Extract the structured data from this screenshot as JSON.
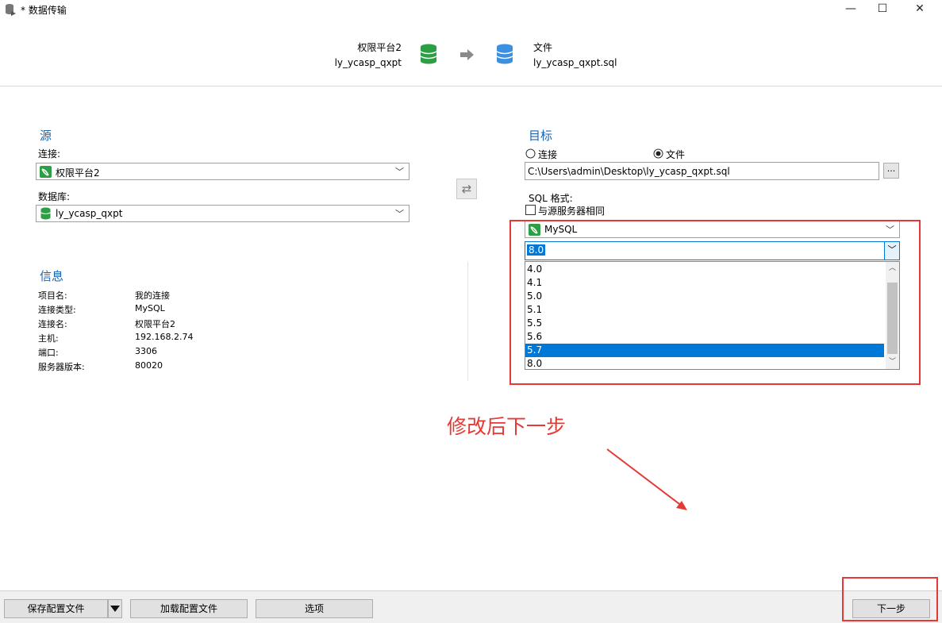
{
  "window": {
    "title": "* 数据传输",
    "minimize": "—",
    "maximize": "☐",
    "close": "✕"
  },
  "header": {
    "source_line1": "权限平台2",
    "source_line2": "ly_ycasp_qxpt",
    "target_line1": "文件",
    "target_line2": "ly_ycasp_qxpt.sql"
  },
  "source": {
    "title": "源",
    "connection_label": "连接:",
    "connection_value": "权限平台2",
    "database_label": "数据库:",
    "database_value": "ly_ycasp_qxpt"
  },
  "info": {
    "title": "信息",
    "rows": [
      {
        "label": "项目名:",
        "value": "我的连接"
      },
      {
        "label": "连接类型:",
        "value": "MySQL"
      },
      {
        "label": "连接名:",
        "value": "权限平台2"
      },
      {
        "label": "主机:",
        "value": "192.168.2.74"
      },
      {
        "label": "端口:",
        "value": "3306"
      },
      {
        "label": "服务器版本:",
        "value": "80020"
      }
    ]
  },
  "target": {
    "title": "目标",
    "radio_connection": "连接",
    "radio_file": "文件",
    "selected_radio": "文件",
    "file_path": "C:\\Users\\admin\\Desktop\\ly_ycasp_qxpt.sql",
    "browse_label": "...",
    "sql_format_label": "SQL 格式:",
    "same_as_source_label": "与源服务器相同",
    "same_as_source_checked": false,
    "format_value": "MySQL",
    "version_value": "8.0",
    "version_options": [
      "4.0",
      "4.1",
      "5.0",
      "5.1",
      "5.5",
      "5.6",
      "5.7",
      "8.0"
    ],
    "highlighted_option": "5.7"
  },
  "annotation": {
    "text": "修改后下一步",
    "color": "#e53935"
  },
  "buttons": {
    "save_profile": "保存配置文件",
    "load_profile": "加载配置文件",
    "options": "选项",
    "next": "下一步"
  },
  "colors": {
    "accent_blue": "#1a64b4",
    "selection": "#0078d7",
    "annotation_red": "#e53935",
    "db_green": "#2e9e44",
    "db_blue": "#3d8fe0"
  }
}
